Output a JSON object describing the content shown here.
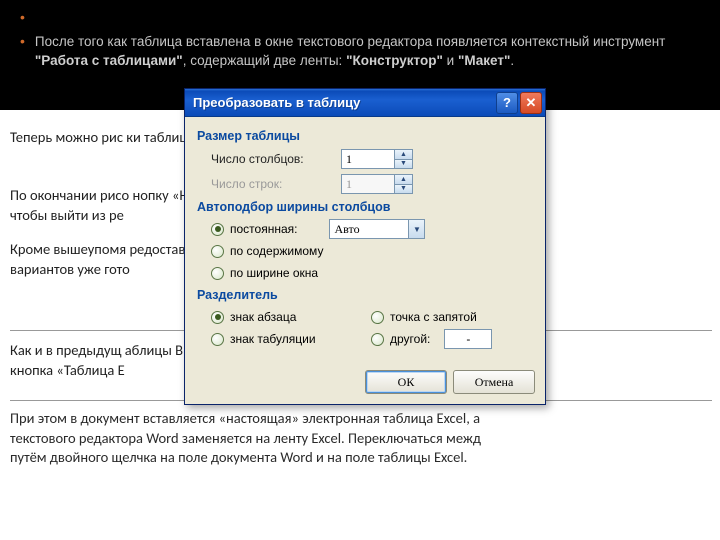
{
  "slide": {
    "bullets": [
      {
        "text": ""
      },
      {
        "html_parts": [
          "После того как таблица вставлена в окне текстового редактора появляется контекстный инструмент ",
          "\"Работа с таблицами\"",
          ", содержащий две ленты: ",
          "\"Конструктор\"",
          " и ",
          "\"Макет\"",
          "."
        ]
      }
    ]
  },
  "bg": {
    "line1": "Теперь можно рис                                                                                                                            ки таблиц",
    "line2": "По окончании рисо                                                                                                                          нопку «На\nчтобы выйти из ре",
    "line3": "Кроме вышеупомя                                                                                                                            редостав\nвариантов уже гото",
    "line4": "Как и в предыдущ                                                                                                                            аблицы В\nкнопка «Таблица E",
    "line5": "При этом в документ вставляется «настоящая» электронная  таблица Excel, а\nтекстового редактора Word заменяется на ленту Excel. Переключаться межд\nпутём двойного щелчка на поле документа Word и на поле таблицы Excel."
  },
  "dialog": {
    "title": "Преобразовать в таблицу",
    "sections": {
      "size": "Размер таблицы",
      "autofit": "Автоподбор ширины столбцов",
      "separator": "Разделитель"
    },
    "labels": {
      "cols": "Число столбцов:",
      "rows": "Число строк:",
      "fixed": "постоянная:",
      "byContent": "по содержимому",
      "byWindow": "по ширине окна",
      "para": "знак абзаца",
      "semicolon": "точка с запятой",
      "tab": "знак табуляции",
      "other": "другой:"
    },
    "values": {
      "cols": "1",
      "rows": "1",
      "fixedCombo": "Авто",
      "other": "-"
    },
    "buttons": {
      "ok": "ОК",
      "cancel": "Отмена"
    }
  }
}
